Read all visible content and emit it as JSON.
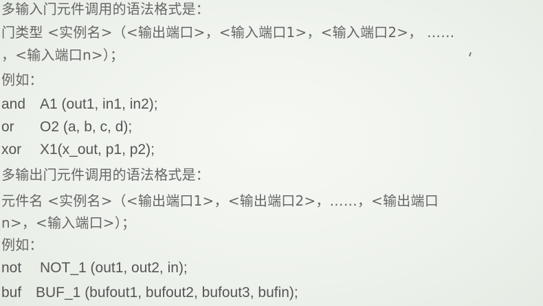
{
  "lines": {
    "l1": "多输入门元件调用的语法格式是：",
    "l2": "门类型 <实例名>（<输出端口>，<输入端口1>，<输入端口2>， ……",
    "l3": "，<输入端口n>）；",
    "l4": "例如：",
    "l8": "多输出门元件调用的语法格式是：",
    "l9": "元件名 <实例名>（<输出端口1>，<输出端口2>，……，<输出端口",
    "l10": "n>，<输入端口>）；",
    "l11": "例如："
  },
  "examples1": [
    {
      "keyword": "and",
      "statement": "A1 (out1, in1, in2);"
    },
    {
      "keyword": "or",
      "statement": "O2 (a, b, c, d);"
    },
    {
      "keyword": "xor",
      "statement": "X1(x_out, p1, p2);"
    }
  ],
  "examples2": [
    {
      "keyword": "not",
      "statement": "NOT_1 (out1, out2, in);"
    },
    {
      "keyword": "buf",
      "statement": "BUF_1 (bufout1, bufout2, bufout3, bufin);"
    }
  ]
}
